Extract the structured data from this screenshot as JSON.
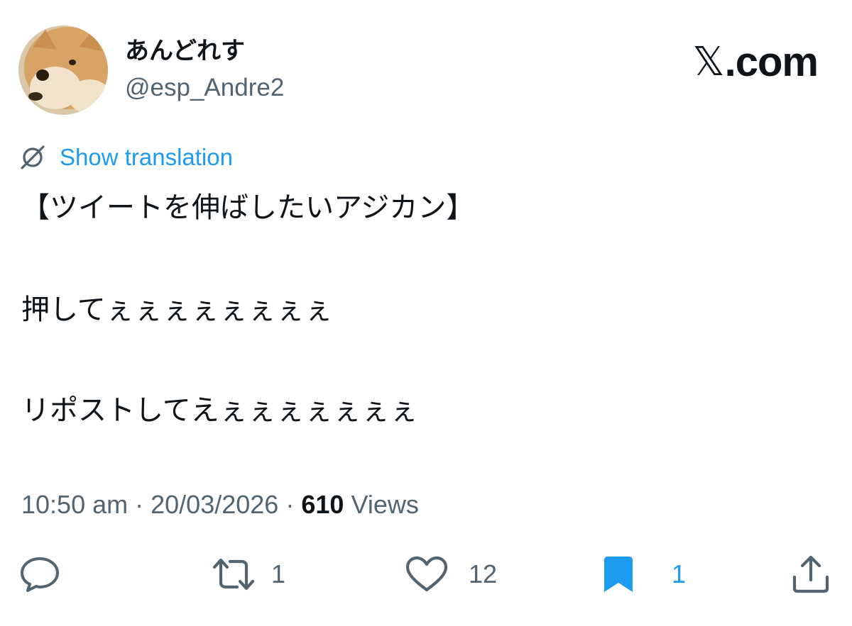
{
  "author": {
    "display_name": "あんどれす",
    "handle": "@esp_Andre2"
  },
  "brand": {
    "logo_glyph": "𝕏",
    "domain": ".com"
  },
  "translation": {
    "label": "Show translation",
    "icon": "translate-globe-icon"
  },
  "tweet": {
    "lines": [
      "【ツイートを伸ばしたいアジカン】",
      "押してぇぇぇぇぇぇぇぇ",
      "リポストしてえぇぇぇぇぇぇぇ"
    ]
  },
  "meta": {
    "time": "10:50 am",
    "separator": "·",
    "date": "20/03/2026",
    "views_count": "610",
    "views_label": "Views"
  },
  "actions": {
    "reply": {
      "icon": "reply-icon",
      "count": ""
    },
    "repost": {
      "icon": "repost-icon",
      "count": "1"
    },
    "like": {
      "icon": "heart-icon",
      "count": "12"
    },
    "bookmark": {
      "icon": "bookmark-icon",
      "count": "1",
      "active": true
    },
    "share": {
      "icon": "share-icon",
      "count": ""
    }
  },
  "colors": {
    "accent": "#1d9bf0",
    "text": "#0f1419",
    "secondary_text": "#536471",
    "icon": "#536471"
  }
}
